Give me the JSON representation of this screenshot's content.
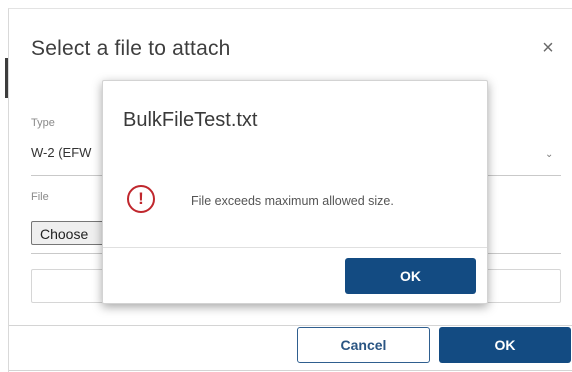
{
  "dialog": {
    "title": "Select a file to attach",
    "close_glyph": "×",
    "type_label": "Type",
    "type_value": "W-2 (EFW",
    "file_label": "File",
    "choose_button_label": "Choose",
    "cancel_label": "Cancel",
    "ok_label": "OK"
  },
  "alert": {
    "title": "BulkFileTest.txt",
    "icon": "error-circle-icon",
    "message": "File exceeds maximum allowed size.",
    "ok_label": "OK"
  },
  "colors": {
    "primary": "#134b82",
    "error": "#c0272d"
  }
}
